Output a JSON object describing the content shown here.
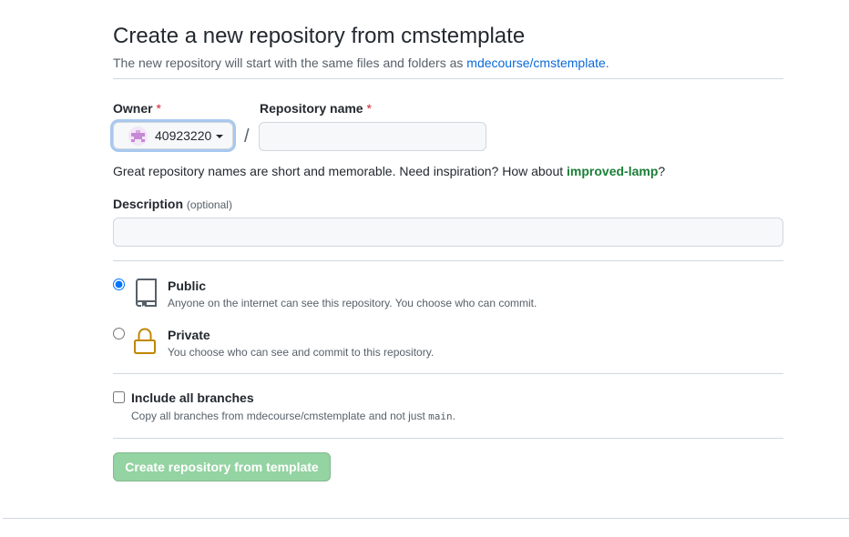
{
  "page": {
    "title": "Create a new repository from cmstemplate",
    "subtitle_prefix": "The new repository will start with the same files and folders as ",
    "subtitle_link": "mdecourse/cmstemplate",
    "subtitle_suffix": "."
  },
  "owner": {
    "label": "Owner",
    "required_mark": "*",
    "value": "40923220"
  },
  "separator": "/",
  "repo_name": {
    "label": "Repository name",
    "required_mark": "*",
    "value": "",
    "placeholder": ""
  },
  "hint": {
    "prefix": "Great repository names are short and memorable. Need inspiration? How about ",
    "suggestion": "improved-lamp",
    "suffix": "?"
  },
  "description": {
    "label": "Description",
    "optional": "(optional)",
    "value": "",
    "placeholder": ""
  },
  "visibility": {
    "selected": "public",
    "public": {
      "label": "Public",
      "desc": "Anyone on the internet can see this repository. You choose who can commit.",
      "icon": "repo-icon"
    },
    "private": {
      "label": "Private",
      "desc": "You choose who can see and commit to this repository.",
      "icon": "lock-icon"
    }
  },
  "branches": {
    "checked": false,
    "label": "Include all branches",
    "desc_prefix": "Copy all branches from mdecourse/cmstemplate and not just ",
    "desc_code": "main",
    "desc_suffix": "."
  },
  "submit": {
    "label": "Create repository from template",
    "color": "#94d3a2"
  },
  "colors": {
    "link": "#0969da",
    "suggestion": "#1a7f37",
    "required": "#cf222e",
    "lock_icon": "#bf8700"
  }
}
